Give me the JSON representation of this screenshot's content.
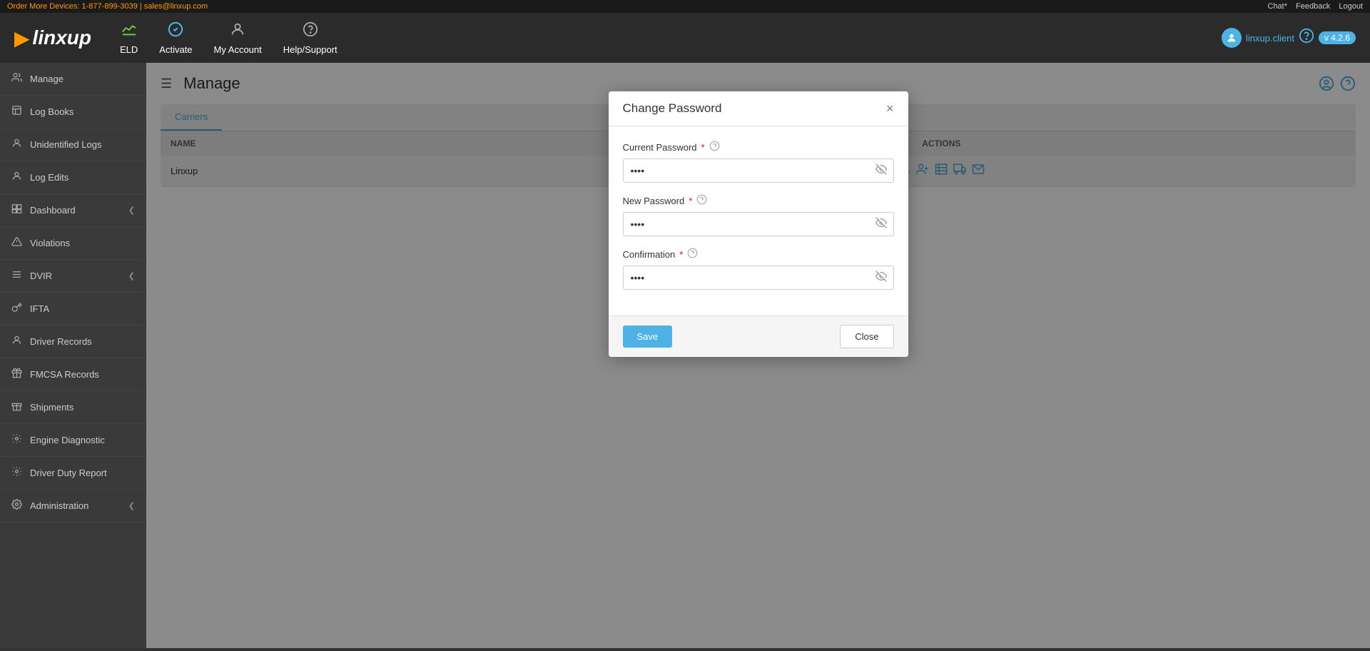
{
  "announcement": {
    "text": "Order More Devices: 1-877-899-3039 | sales@linxup.com",
    "links": [
      "Chat*",
      "Feedback",
      "Logout"
    ]
  },
  "logo": {
    "arrow": "▶",
    "name": "linxup"
  },
  "navbar": {
    "items": [
      {
        "id": "eld",
        "icon": "📊",
        "label": "ELD",
        "iconClass": "green"
      },
      {
        "id": "activate",
        "icon": "✅",
        "label": "Activate",
        "iconClass": "blue"
      },
      {
        "id": "myaccount",
        "icon": "⚙",
        "label": "My Account",
        "iconClass": "grey"
      },
      {
        "id": "helpsupport",
        "icon": "❓",
        "label": "Help/Support",
        "iconClass": "grey"
      }
    ],
    "user": "linxup.client",
    "version": "v 4.2.6"
  },
  "sidebar": {
    "items": [
      {
        "id": "manage",
        "icon": "👥",
        "label": "Manage",
        "hasChevron": false
      },
      {
        "id": "logbooks",
        "icon": "📋",
        "label": "Log Books",
        "hasChevron": false
      },
      {
        "id": "unidentifiedlogs",
        "icon": "👤",
        "label": "Unidentified Logs",
        "hasChevron": false
      },
      {
        "id": "logedits",
        "icon": "👤",
        "label": "Log Edits",
        "hasChevron": false
      },
      {
        "id": "dashboard",
        "icon": "📊",
        "label": "Dashboard",
        "hasChevron": true
      },
      {
        "id": "violations",
        "icon": "⚠",
        "label": "Violations",
        "hasChevron": false
      },
      {
        "id": "dvir",
        "icon": "≡",
        "label": "DVIR",
        "hasChevron": true
      },
      {
        "id": "ifta",
        "icon": "🔑",
        "label": "IFTA",
        "hasChevron": false
      },
      {
        "id": "driverrecords",
        "icon": "👤",
        "label": "Driver Records",
        "hasChevron": false
      },
      {
        "id": "fmcsarecords",
        "icon": "🎁",
        "label": "FMCSA Records",
        "hasChevron": false
      },
      {
        "id": "shipments",
        "icon": "🎁",
        "label": "Shipments",
        "hasChevron": false
      },
      {
        "id": "enginediagnostic",
        "icon": "🔧",
        "label": "Engine Diagnostic",
        "hasChevron": false
      },
      {
        "id": "driverdutreport",
        "icon": "🔧",
        "label": "Driver Duty Report",
        "hasChevron": false
      },
      {
        "id": "administration",
        "icon": "⚙",
        "label": "Administration",
        "hasChevron": true
      }
    ]
  },
  "main": {
    "page_title": "Manage",
    "table": {
      "tabs": [
        "Carriers"
      ],
      "columns": [
        "NAME",
        "ACTIONS"
      ],
      "rows": [
        {
          "name": "Linxup",
          "actions": true
        }
      ]
    }
  },
  "modal": {
    "title": "Change Password",
    "fields": [
      {
        "id": "current",
        "label": "Current Password",
        "required": true,
        "placeholder": "••••"
      },
      {
        "id": "new",
        "label": "New Password",
        "required": true,
        "placeholder": "••••"
      },
      {
        "id": "confirm",
        "label": "Confirmation",
        "required": true,
        "placeholder": "••••"
      }
    ],
    "save_label": "Save",
    "close_label": "Close"
  }
}
